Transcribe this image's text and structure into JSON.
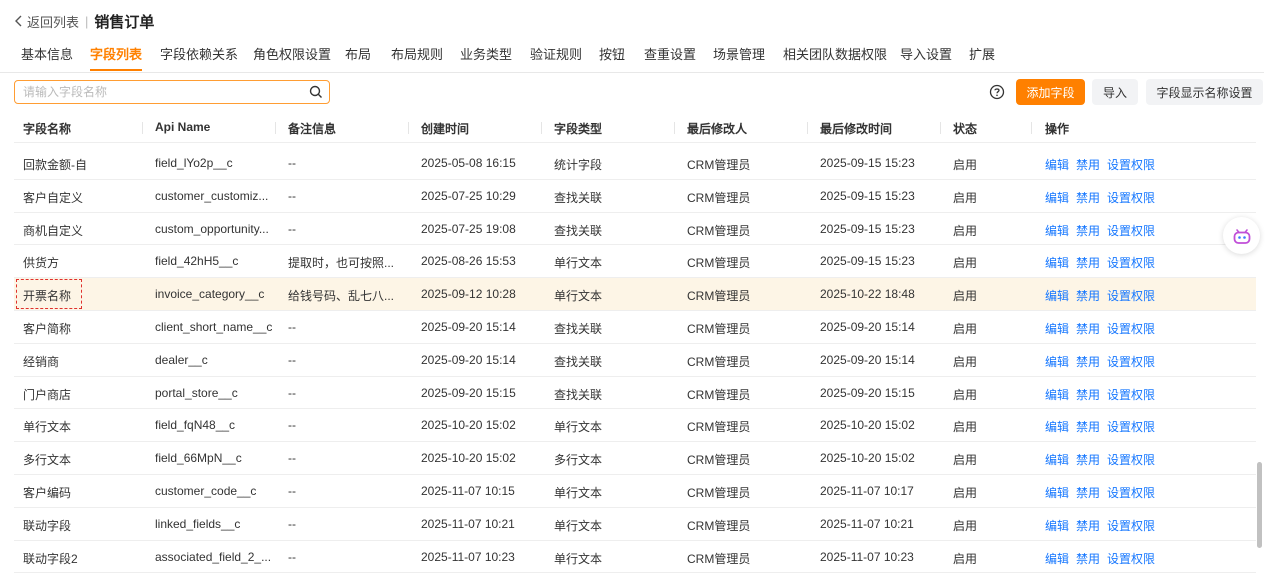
{
  "header": {
    "back_label": "返回列表",
    "separator": "|",
    "title": "销售订单"
  },
  "tabs": [
    {
      "label": "基本信息",
      "active": false
    },
    {
      "label": "字段列表",
      "active": true
    },
    {
      "label": "字段依赖关系",
      "active": false
    },
    {
      "label": "角色权限设置",
      "active": false
    },
    {
      "label": "布局",
      "active": false
    },
    {
      "label": "布局规则",
      "active": false
    },
    {
      "label": "业务类型",
      "active": false
    },
    {
      "label": "验证规则",
      "active": false
    },
    {
      "label": "按钮",
      "active": false
    },
    {
      "label": "查重设置",
      "active": false
    },
    {
      "label": "场景管理",
      "active": false
    },
    {
      "label": "相关团队数据权限",
      "active": false
    },
    {
      "label": "导入设置",
      "active": false
    },
    {
      "label": "扩展",
      "active": false
    }
  ],
  "search": {
    "placeholder": "请输入字段名称",
    "value": ""
  },
  "toolbar": {
    "add_label": "添加字段",
    "import_label": "导入",
    "display_name_label": "字段显示名称设置"
  },
  "table": {
    "columns": [
      "字段名称",
      "Api Name",
      "备注信息",
      "创建时间",
      "字段类型",
      "最后修改人",
      "最后修改时间",
      "状态",
      "操作"
    ],
    "actions": [
      "编辑",
      "禁用",
      "设置权限"
    ],
    "rows": [
      [
        "回款金额-自",
        "field_lYo2p__c",
        "--",
        "2025-05-08 16:15",
        "统计字段",
        "CRM管理员",
        "2025-09-15 15:23",
        "启用"
      ],
      [
        "客户自定义",
        "customer_customiz...",
        "--",
        "2025-07-25 10:29",
        "查找关联",
        "CRM管理员",
        "2025-09-15 15:23",
        "启用"
      ],
      [
        "商机自定义",
        "custom_opportunity...",
        "--",
        "2025-07-25 19:08",
        "查找关联",
        "CRM管理员",
        "2025-09-15 15:23",
        "启用"
      ],
      [
        "供货方",
        "field_42hH5__c",
        "提取时，也可按照...",
        "2025-08-26 15:53",
        "单行文本",
        "CRM管理员",
        "2025-09-15 15:23",
        "启用"
      ],
      [
        "开票名称",
        "invoice_category__c",
        "给钱号码、乱七八...",
        "2025-09-12 10:28",
        "单行文本",
        "CRM管理员",
        "2025-10-22 18:48",
        "启用"
      ],
      [
        "客户简称",
        "client_short_name__c",
        "--",
        "2025-09-20 15:14",
        "查找关联",
        "CRM管理员",
        "2025-09-20 15:14",
        "启用"
      ],
      [
        "经销商",
        "dealer__c",
        "--",
        "2025-09-20 15:14",
        "查找关联",
        "CRM管理员",
        "2025-09-20 15:14",
        "启用"
      ],
      [
        "门户商店",
        "portal_store__c",
        "--",
        "2025-09-20 15:15",
        "查找关联",
        "CRM管理员",
        "2025-09-20 15:15",
        "启用"
      ],
      [
        "单行文本",
        "field_fqN48__c",
        "--",
        "2025-10-20 15:02",
        "单行文本",
        "CRM管理员",
        "2025-10-20 15:02",
        "启用"
      ],
      [
        "多行文本",
        "field_66MpN__c",
        "--",
        "2025-10-20 15:02",
        "多行文本",
        "CRM管理员",
        "2025-10-20 15:02",
        "启用"
      ],
      [
        "客户编码",
        "customer_code__c",
        "--",
        "2025-11-07 10:15",
        "单行文本",
        "CRM管理员",
        "2025-11-07 10:17",
        "启用"
      ],
      [
        "联动字段",
        "linked_fields__c",
        "--",
        "2025-11-07 10:21",
        "单行文本",
        "CRM管理员",
        "2025-11-07 10:21",
        "启用"
      ],
      [
        "联动字段2",
        "associated_field_2_...",
        "--",
        "2025-11-07 10:23",
        "单行文本",
        "CRM管理员",
        "2025-11-07 10:23",
        "启用"
      ]
    ],
    "highlight_row": 4
  },
  "colors": {
    "accent": "#ff8000",
    "link": "#1677ff",
    "highlight_bg": "#fdf5e6",
    "marker": "#e0312c"
  }
}
